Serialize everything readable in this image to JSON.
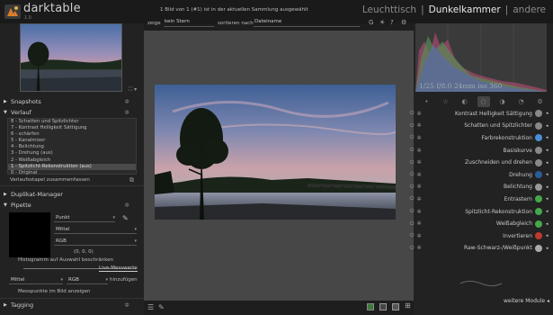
{
  "app": {
    "name": "darktable",
    "version": "1.0"
  },
  "status": "1 Bild von 1 (#1) ist in der aktuellen Sammlung ausgewählt",
  "views": [
    {
      "label": "Leuchttisch",
      "active": false
    },
    {
      "label": "|",
      "active": false
    },
    {
      "label": "Dunkelkammer",
      "active": true
    },
    {
      "label": "|",
      "active": false
    },
    {
      "label": "andere",
      "active": false
    }
  ],
  "filter": {
    "show_label": "zeige",
    "show_value": "kein Stern",
    "sort_label": "sortieren nach",
    "sort_value": "Dateiname",
    "icons": [
      "G",
      "☀",
      "?",
      "⚙"
    ]
  },
  "left": {
    "snapshots_label": "Snapshots",
    "history_label": "Verlauf",
    "history_items": [
      {
        "label": "8 - Schatten und Spitzlichter",
        "selected": false
      },
      {
        "label": "7 - Kontrast Helligkeit Sättigung",
        "selected": false
      },
      {
        "label": "6 - schärfen",
        "selected": false
      },
      {
        "label": "5 - Kanalmixer",
        "selected": false
      },
      {
        "label": "4 - Belichtung",
        "selected": false
      },
      {
        "label": "3 - Drehung (aus)",
        "selected": false
      },
      {
        "label": "2 - Weißabgleich",
        "selected": false
      },
      {
        "label": "1 - Spitzlicht-Rekonstruktion (aus)",
        "selected": true
      },
      {
        "label": "0 - Original",
        "selected": false
      }
    ],
    "compress_label": "Verlaufsstapel zusammenfassen",
    "duplicate_label": "Duplikat-Manager",
    "picker_label": "Pipette",
    "picker_mode": "Punkt",
    "picker_stat": "Mittel",
    "picker_space": "RGB",
    "picker_values": "(0, 0, 0)",
    "histo_area_label": "Histogramm auf Auswahl beschränken",
    "live_label": "Live-Messwerte",
    "sample_stat": "Mittel",
    "sample_space": "RGB",
    "sample_add": "hinzufügen",
    "show_sample_label": "Messpunkte im Bild anzeigen",
    "tagging_label": "Tagging"
  },
  "right": {
    "exif": "1/25 f/8.0 24mm iso 360",
    "tabs": [
      "•",
      "☆",
      "◐",
      "○",
      "◑",
      "◔",
      "⚙"
    ],
    "active_tab": 3,
    "modules": [
      {
        "name": "Kontrast Helligkeit Sättigung",
        "color": "#888888"
      },
      {
        "name": "Schatten und Spitzlichter",
        "color": "#888888"
      },
      {
        "name": "Farbrekonstruktion",
        "color": "#4a8fd6"
      },
      {
        "name": "Basiskurve",
        "color": "#888888"
      },
      {
        "name": "Zuschneiden und drehen",
        "color": "#888888"
      },
      {
        "name": "Drehung",
        "color": "#2b5d9a"
      },
      {
        "name": "Belichtung",
        "color": "#999999"
      },
      {
        "name": "Entrastern",
        "color": "#44a84a"
      },
      {
        "name": "Spitzlicht-Rekonstruktion",
        "color": "#44a84a"
      },
      {
        "name": "Weißabgleich",
        "color": "#44a84a"
      },
      {
        "name": "Invertieren",
        "color": "#c0392b"
      },
      {
        "name": "Raw-Schwarz-/Weißpunkt",
        "color": "#aaaaaa"
      }
    ],
    "more_label": "weitere Module"
  },
  "colors": {
    "accent": "#cfcfcf",
    "bg": "#1e1e1e",
    "panel": "#222222",
    "center": "#474747"
  }
}
